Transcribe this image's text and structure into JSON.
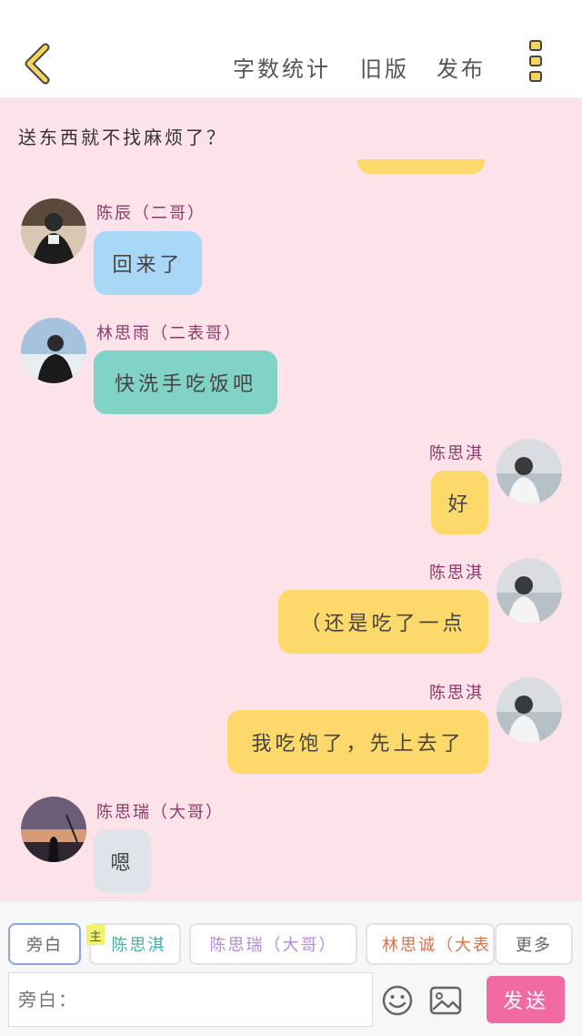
{
  "header": {
    "word_count": "字数统计",
    "old_version": "旧版",
    "publish": "发布"
  },
  "chat": {
    "narration": "送东西就不找麻烦了？",
    "messages": [
      {
        "sender": "陈辰（二哥）",
        "text": "回来了",
        "side": "left",
        "bubble_color": "#a9d8f7"
      },
      {
        "sender": "林思雨（二表哥）",
        "text": "快洗手吃饭吧",
        "side": "left",
        "bubble_color": "#80d3c6"
      },
      {
        "sender": "陈思淇",
        "text": "好",
        "side": "right",
        "bubble_color": "#fcd96a"
      },
      {
        "sender": "陈思淇",
        "text": "（还是吃了一点",
        "side": "right",
        "bubble_color": "#fcd96a"
      },
      {
        "sender": "陈思淇",
        "text": "我吃饱了，先上去了",
        "side": "right",
        "bubble_color": "#fcd96a"
      },
      {
        "sender": "陈思瑞（大哥）",
        "text": "嗯",
        "side": "left",
        "bubble_color": "#dfe3ea"
      }
    ]
  },
  "bottom": {
    "tabs": [
      {
        "label": "旁白",
        "color": "#666666"
      },
      {
        "label": "陈思淇",
        "color": "#3fb3a3",
        "badge": "主"
      },
      {
        "label": "陈思瑞（大哥）",
        "color": "#b58ad6"
      },
      {
        "label": "林思诚（大表",
        "color": "#d9734a"
      },
      {
        "label": "更多",
        "color": "#666666"
      }
    ],
    "input_placeholder": "旁白：",
    "send": "发送"
  },
  "colors": {
    "background": "#fbe3e9",
    "accent_yellow": "#f4d35e",
    "send_pink": "#f26aa3"
  }
}
